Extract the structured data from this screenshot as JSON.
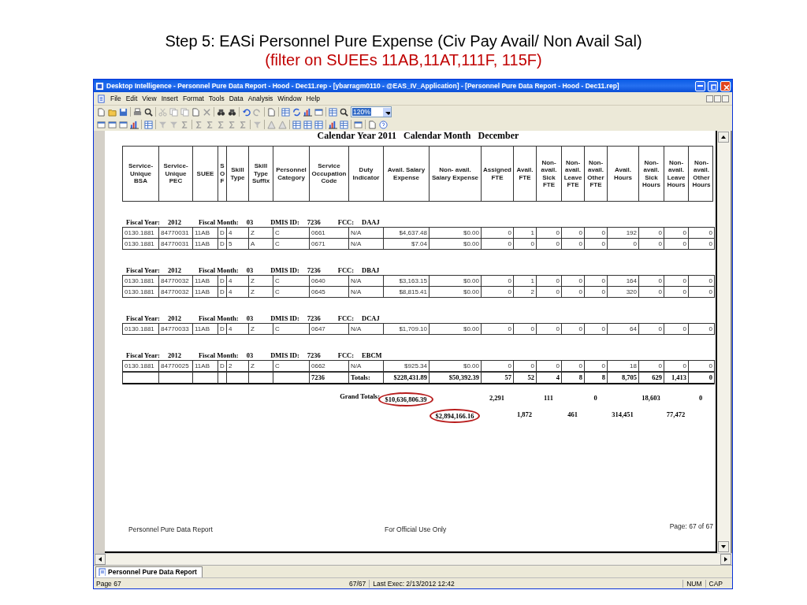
{
  "slide": {
    "title": "Step 5: EASi Personnel Pure Expense (Civ Pay Avail/ Non Avail Sal)",
    "subtitle": "(filter on SUEEs 11AB,11AT,111F, 115F)"
  },
  "window": {
    "title": "Desktop Intelligence - Personnel Pure Data Report - Hood - Dec11.rep - [ybarragm0110 - @EAS_IV_Application] - [Personnel Pure Data Report - Hood - Dec11.rep]"
  },
  "menu": [
    "File",
    "Edit",
    "View",
    "Insert",
    "Format",
    "Tools",
    "Data",
    "Analysis",
    "Window",
    "Help"
  ],
  "zoom": {
    "value": "120%"
  },
  "report": {
    "heading": "Calendar Year 2011   Calendar Month   December",
    "columns": [
      "Service- Unique BSA",
      "Service- Unique PEC",
      "SUEE",
      "S O F",
      "Skill Type",
      "Skill Type Suffix",
      "Personnel Category",
      "Service Occupation Code",
      "Duty Indicator",
      "Avail. Salary Expense",
      "Non- avail. Salary Expense",
      "Assigned FTE",
      "Avail. FTE",
      "Non- avail. Sick FTE",
      "Non- avail. Leave FTE",
      "Non- avail. Other FTE",
      "Avail. Hours",
      "Non- avail. Sick Hours",
      "Non- avail. Leave Hours",
      "Non- avail. Other Hours"
    ],
    "groups": [
      {
        "header": [
          {
            "label": "Fiscal Year:",
            "value": "2012"
          },
          {
            "label": "Fiscal Month:",
            "value": "03"
          },
          {
            "label": "DMIS ID:",
            "value": "7236"
          },
          {
            "label": "FCC:",
            "value": "DAAJ"
          }
        ],
        "rows": [
          [
            "0130.1881",
            "84770031",
            "11AB",
            "D",
            "4",
            "Z",
            "C",
            "0661",
            "N/A",
            "$4,637.48",
            "$0.00",
            "0",
            "1",
            "0",
            "0",
            "0",
            "192",
            "0",
            "0",
            "0"
          ],
          [
            "0130.1881",
            "84770031",
            "11AB",
            "D",
            "5",
            "A",
            "C",
            "0671",
            "N/A",
            "$7.04",
            "$0.00",
            "0",
            "0",
            "0",
            "0",
            "0",
            "0",
            "0",
            "0",
            "0"
          ]
        ]
      },
      {
        "header": [
          {
            "label": "Fiscal Year:",
            "value": "2012"
          },
          {
            "label": "Fiscal Month:",
            "value": "03"
          },
          {
            "label": "DMIS ID:",
            "value": "7236"
          },
          {
            "label": "FCC:",
            "value": "DBAJ"
          }
        ],
        "rows": [
          [
            "0130.1881",
            "84770032",
            "11AB",
            "D",
            "4",
            "Z",
            "C",
            "0640",
            "N/A",
            "$3,163.15",
            "$0.00",
            "0",
            "1",
            "0",
            "0",
            "0",
            "164",
            "0",
            "0",
            "0"
          ],
          [
            "0130.1881",
            "84770032",
            "11AB",
            "D",
            "4",
            "Z",
            "C",
            "0645",
            "N/A",
            "$8,815.41",
            "$0.00",
            "0",
            "2",
            "0",
            "0",
            "0",
            "320",
            "0",
            "0",
            "0"
          ]
        ]
      },
      {
        "header": [
          {
            "label": "Fiscal Year:",
            "value": "2012"
          },
          {
            "label": "Fiscal Month:",
            "value": "03"
          },
          {
            "label": "DMIS ID:",
            "value": "7236"
          },
          {
            "label": "FCC:",
            "value": "DCAJ"
          }
        ],
        "rows": [
          [
            "0130.1881",
            "84770033",
            "11AB",
            "D",
            "4",
            "Z",
            "C",
            "0647",
            "N/A",
            "$1,709.10",
            "$0.00",
            "0",
            "0",
            "0",
            "0",
            "0",
            "64",
            "0",
            "0",
            "0"
          ]
        ]
      },
      {
        "header": [
          {
            "label": "Fiscal Year:",
            "value": "2012"
          },
          {
            "label": "Fiscal Month:",
            "value": "03"
          },
          {
            "label": "DMIS ID:",
            "value": "7236"
          },
          {
            "label": "FCC:",
            "value": "EBCM"
          }
        ],
        "rows": [
          [
            "0130.1881",
            "84770025",
            "11AB",
            "D",
            "2",
            "Z",
            "C",
            "0662",
            "N/A",
            "$925.34",
            "$0.00",
            "0",
            "0",
            "0",
            "0",
            "0",
            "18",
            "0",
            "0",
            "0"
          ]
        ],
        "totals": {
          "dmis_id": "7236",
          "label": "Totals:",
          "values": [
            "$228,431.89",
            "$50,392.39",
            "57",
            "52",
            "4",
            "8",
            "8",
            "8,705",
            "629",
            "1,413",
            "0"
          ]
        }
      }
    ],
    "grand_totals": {
      "label": "Grand Totals:",
      "values": [
        {
          "text": "$10,636,806.39",
          "circled": true
        },
        {
          "text": "$2,894,166.16",
          "circled": true
        },
        {
          "text": "2,291",
          "circled": false
        },
        {
          "text": "1,872",
          "circled": false
        },
        {
          "text": "111",
          "circled": false
        },
        {
          "text": "461",
          "circled": false
        },
        {
          "text": "0",
          "circled": false
        },
        {
          "text": "314,451",
          "circled": false
        },
        {
          "text": "18,603",
          "circled": false
        },
        {
          "text": "77,472",
          "circled": false
        },
        {
          "text": "0",
          "circled": false
        }
      ]
    },
    "footer": {
      "left": "Personnel Pure Data Report",
      "center": "For Official Use Only",
      "right": "Page: 67 of 67"
    }
  },
  "tabs": [
    {
      "label": "Personnel Pure Data Report",
      "selected": true
    }
  ],
  "status_bar": {
    "page": "Page 67",
    "count": "67/67",
    "last_exec": "Last Exec: 2/13/2012 12:42",
    "num": "NUM",
    "cap": "CAP"
  }
}
